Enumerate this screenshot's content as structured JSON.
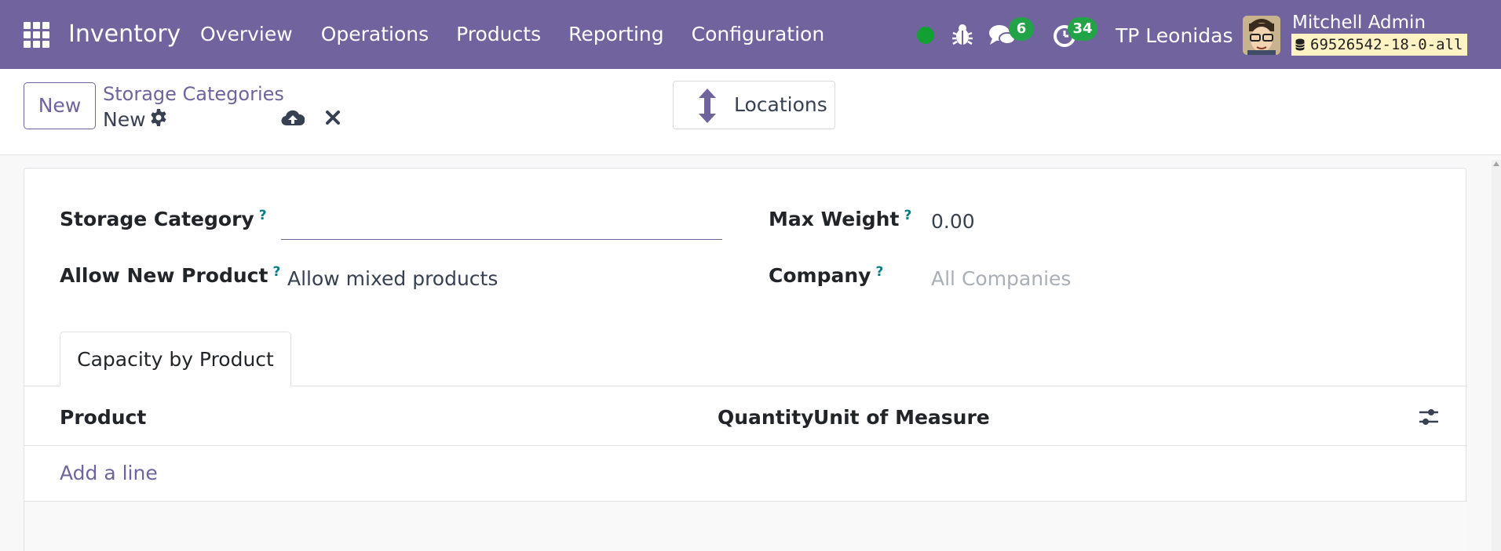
{
  "navbar": {
    "brand": "Inventory",
    "menu": [
      "Overview",
      "Operations",
      "Products",
      "Reporting",
      "Configuration"
    ],
    "chat_count": "6",
    "activity_count": "34",
    "company": "TP Leonidas",
    "user_name": "Mitchell Admin",
    "database": "69526542-18-0-all",
    "icons": [
      "apps-grid-icon",
      "status-dot",
      "bug-icon",
      "chat-icon",
      "activity-clock-icon",
      "database-icon"
    ],
    "colors": {
      "navbar": "#71639e",
      "badge": "#22a347",
      "status": "#12a033",
      "db_badge": "#fff3c4"
    }
  },
  "control": {
    "new_label": "New",
    "breadcrumb": "Storage Categories",
    "record_name": "New",
    "smart_button": "Locations"
  },
  "form": {
    "storage_category_label": "Storage Category",
    "storage_category_value": "",
    "max_weight_label": "Max Weight",
    "max_weight_value": "0.00",
    "allow_new_product_label": "Allow New Product",
    "allow_new_product_value": "Allow mixed products",
    "company_label": "Company",
    "company_placeholder": "All Companies",
    "help_mark": "?"
  },
  "tab": {
    "label": "Capacity by Product"
  },
  "table": {
    "columns": [
      "Product",
      "Quantity",
      "Unit of Measure"
    ],
    "add_line": "Add a line"
  }
}
